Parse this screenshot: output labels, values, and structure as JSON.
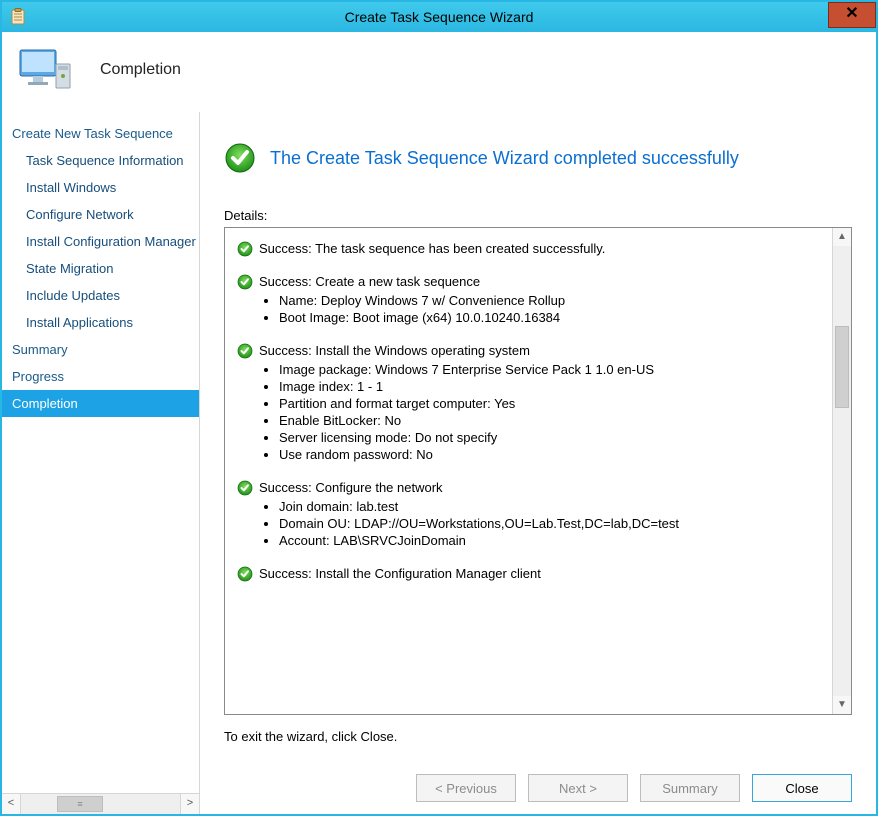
{
  "window": {
    "title": "Create Task Sequence Wizard",
    "close_glyph": "✕"
  },
  "header": {
    "title": "Completion"
  },
  "sidebar": {
    "items": [
      {
        "label": "Create New Task Sequence",
        "indent": 0
      },
      {
        "label": "Task Sequence Information",
        "indent": 1
      },
      {
        "label": "Install Windows",
        "indent": 1
      },
      {
        "label": "Configure Network",
        "indent": 1
      },
      {
        "label": "Install Configuration Manager",
        "indent": 1
      },
      {
        "label": "State Migration",
        "indent": 1
      },
      {
        "label": "Include Updates",
        "indent": 1
      },
      {
        "label": "Install Applications",
        "indent": 1
      },
      {
        "label": "Summary",
        "indent": 0
      },
      {
        "label": "Progress",
        "indent": 0
      },
      {
        "label": "Completion",
        "indent": 0,
        "active": true
      }
    ]
  },
  "main": {
    "success_message": "The Create Task Sequence Wizard completed successfully",
    "details_label": "Details:",
    "blocks": [
      {
        "head": "Success: The task sequence has been created successfully.",
        "items": []
      },
      {
        "head": "Success: Create a new task sequence",
        "items": [
          "Name: Deploy Windows 7 w/ Convenience Rollup",
          "Boot Image: Boot image (x64) 10.0.10240.16384"
        ]
      },
      {
        "head": "Success: Install the Windows operating system",
        "items": [
          "Image package: Windows 7 Enterprise Service Pack 1 1.0 en-US",
          "Image index: 1 - 1",
          "Partition and format target computer: Yes",
          "Enable BitLocker: No",
          "Server licensing mode: Do not specify",
          "Use random password: No"
        ]
      },
      {
        "head": "Success: Configure the network",
        "items": [
          "Join domain: lab.test",
          "Domain OU: LDAP://OU=Workstations,OU=Lab.Test,DC=lab,DC=test",
          "Account: LAB\\SRVCJoinDomain"
        ]
      },
      {
        "head": "Success: Install the Configuration Manager client",
        "items": []
      }
    ],
    "exit_message": "To exit the wizard, click Close."
  },
  "buttons": {
    "previous": "< Previous",
    "next": "Next >",
    "summary": "Summary",
    "close": "Close"
  },
  "icons": {
    "app": "clipboard-icon",
    "monitor": "monitor-icon",
    "check": "check-icon"
  }
}
